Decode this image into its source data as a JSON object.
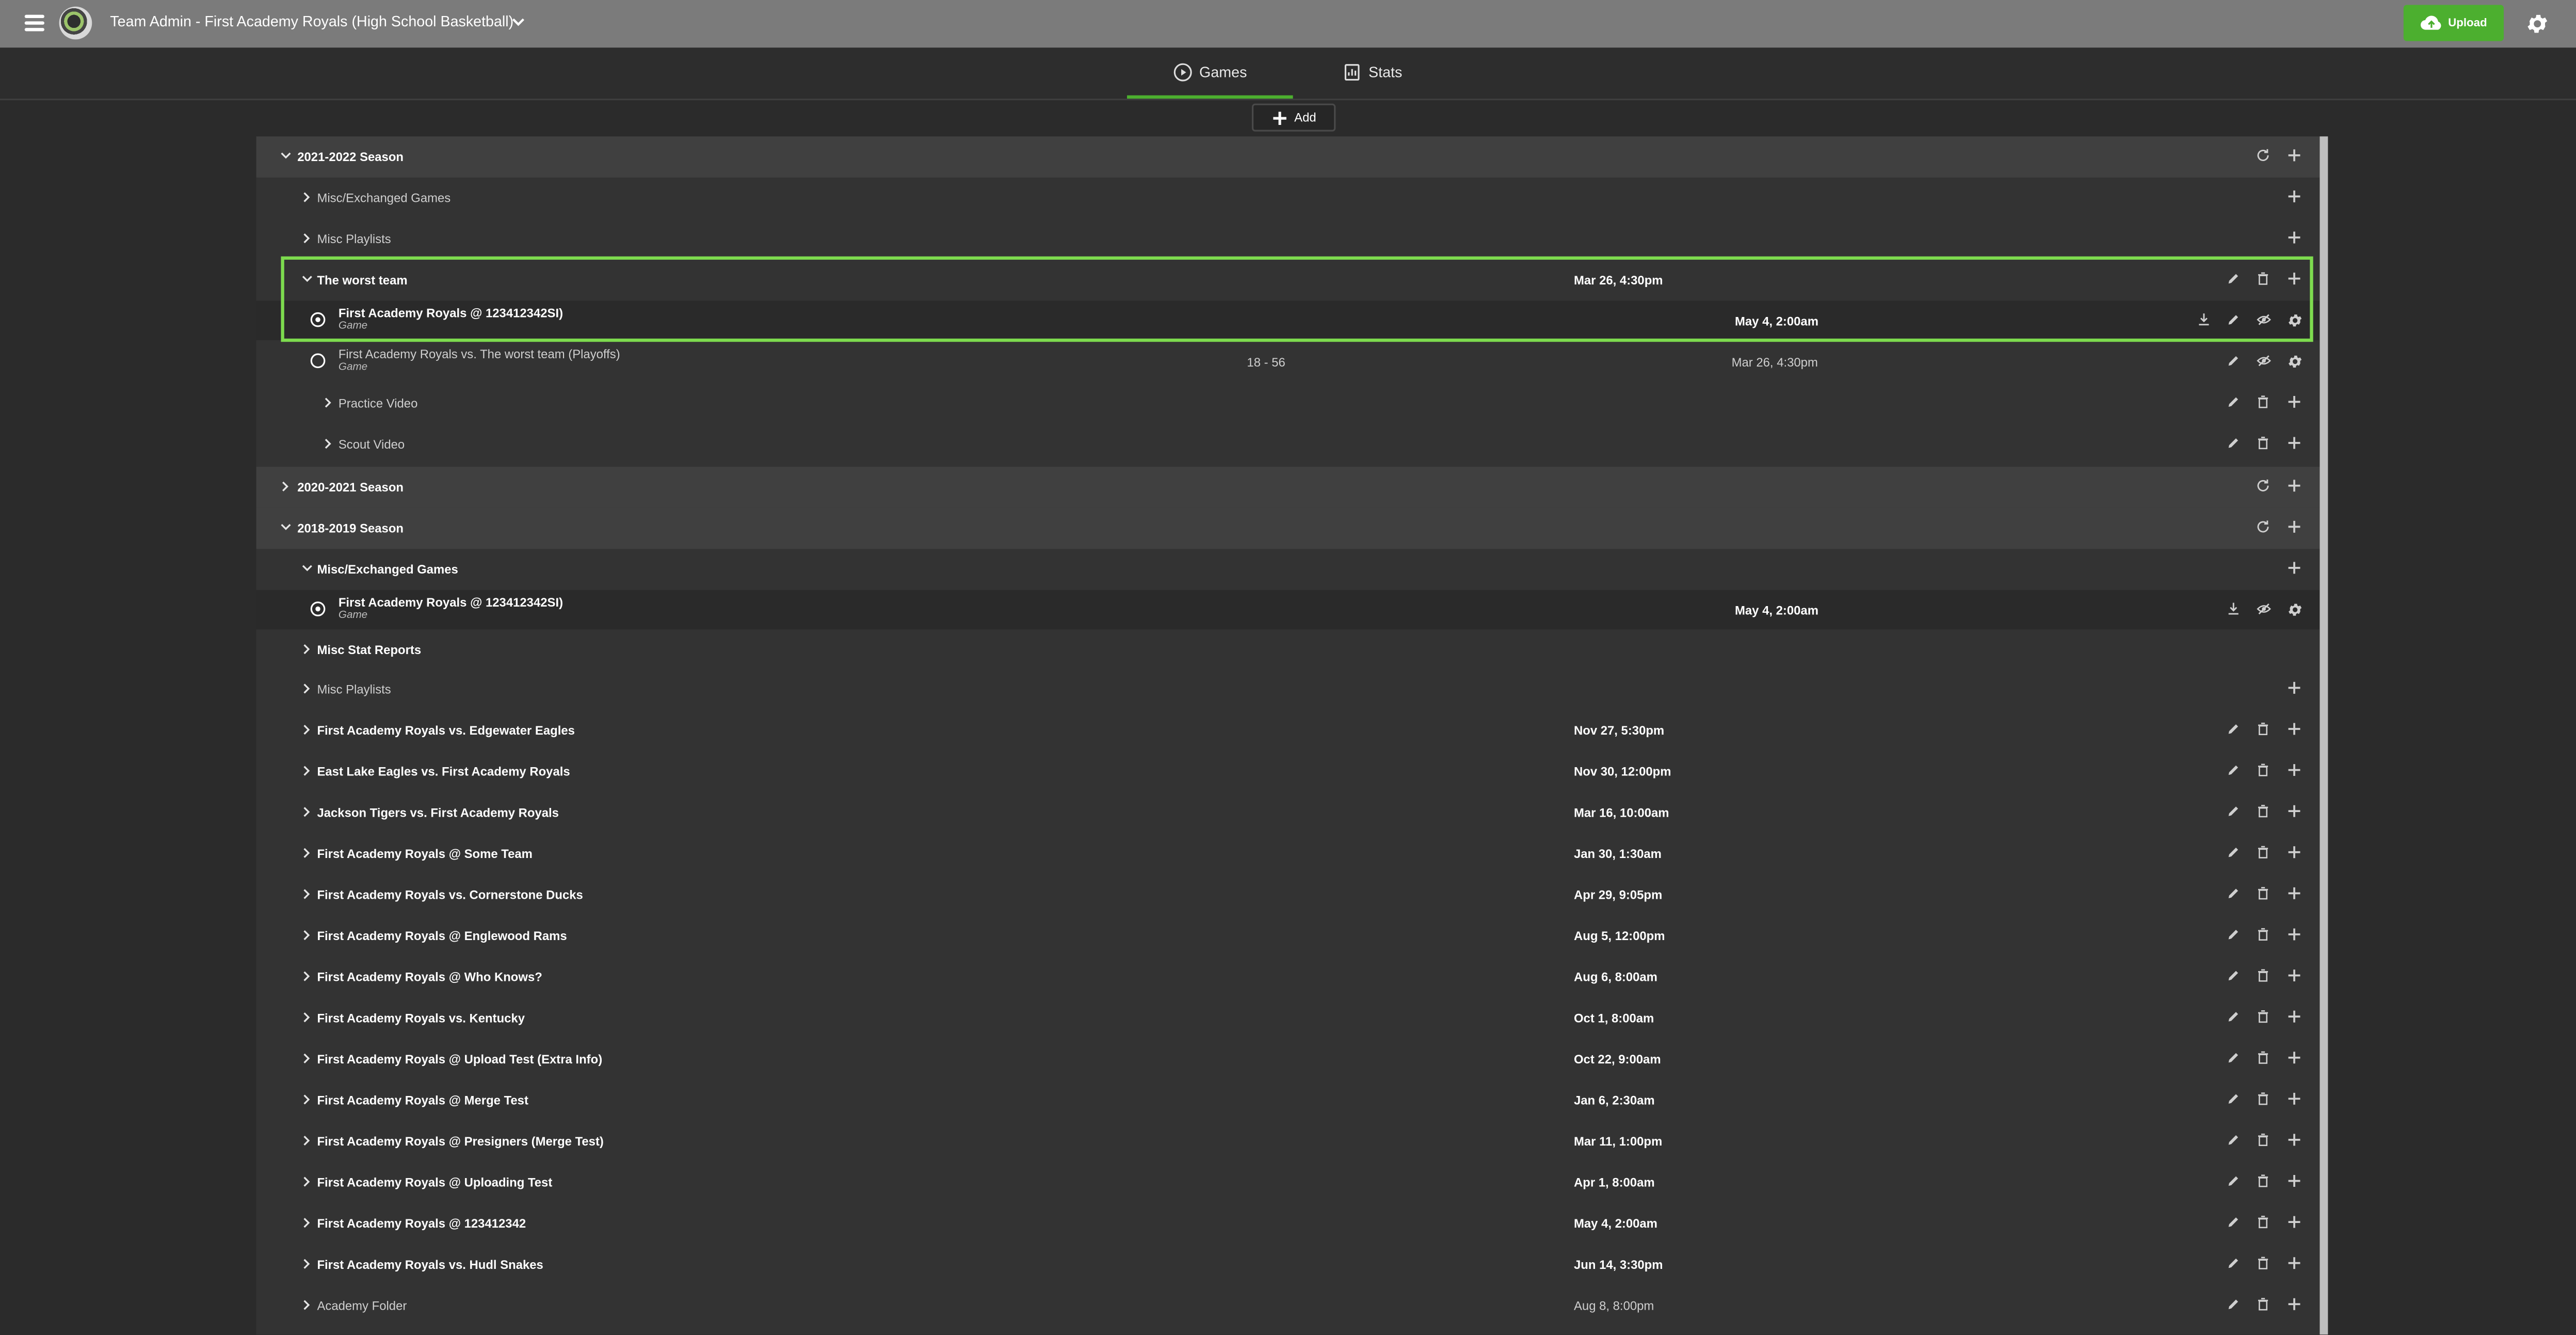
{
  "header": {
    "title": "Team Admin - First Academy Royals (High School Basketball)",
    "upload_label": "Upload",
    "accent_color": "#4caf2f",
    "icons": [
      "menu-icon",
      "team-logo",
      "chevron-down-icon",
      "cloud-upload-icon",
      "gear-icon"
    ]
  },
  "tabs": [
    {
      "label": "Games",
      "active": true
    },
    {
      "label": "Stats",
      "active": false
    }
  ],
  "toolbar": {
    "add_label": "Add"
  },
  "rows": {
    "r0": {
      "label": "2021-2022 Season"
    },
    "r1": {
      "label": "Misc/Exchanged Games"
    },
    "r2": {
      "label": "Misc Playlists"
    },
    "r3": {
      "label": "The worst team",
      "date": "Mar 26, 4:30pm"
    },
    "r4": {
      "label": "First Academy Royals @ 123412342SI)",
      "sub": "Game",
      "date": "May 4, 2:00am"
    },
    "r5": {
      "label": "First Academy Royals vs. The worst team (Playoffs)",
      "sub": "Game",
      "score": "18 - 56",
      "date": "Mar 26, 4:30pm"
    },
    "r6": {
      "label": "Practice Video"
    },
    "r7": {
      "label": "Scout Video"
    },
    "r8": {
      "label": "2020-2021 Season"
    },
    "r9": {
      "label": "2018-2019 Season"
    },
    "r10": {
      "label": "Misc/Exchanged Games"
    },
    "r11": {
      "label": "First Academy Royals @ 123412342SI)",
      "sub": "Game",
      "date": "May 4, 2:00am"
    },
    "r12": {
      "label": "Misc Stat Reports"
    },
    "r13": {
      "label": "Misc Playlists"
    },
    "r14": {
      "label": "First Academy Royals vs. Edgewater Eagles",
      "date": "Nov 27, 5:30pm"
    },
    "r15": {
      "label": "East Lake Eagles vs. First Academy Royals",
      "date": "Nov 30, 12:00pm"
    },
    "r16": {
      "label": "Jackson Tigers vs. First Academy Royals",
      "date": "Mar 16, 10:00am"
    },
    "r17": {
      "label": "First Academy Royals @ Some Team",
      "date": "Jan 30, 1:30am"
    },
    "r18": {
      "label": "First Academy Royals vs. Cornerstone Ducks",
      "date": "Apr 29, 9:05pm"
    },
    "r19": {
      "label": "First Academy Royals @ Englewood Rams",
      "date": "Aug 5, 12:00pm"
    },
    "r20": {
      "label": "First Academy Royals @ Who Knows?",
      "date": "Aug 6, 8:00am"
    },
    "r21": {
      "label": "First Academy Royals vs. Kentucky",
      "date": "Oct 1, 8:00am"
    },
    "r22": {
      "label": "First Academy Royals @ Upload Test (Extra Info)",
      "date": "Oct 22, 9:00am"
    },
    "r23": {
      "label": "First Academy Royals @ Merge Test",
      "date": "Jan 6, 2:30am"
    },
    "r24": {
      "label": "First Academy Royals @ Presigners (Merge Test)",
      "date": "Mar 11, 1:00pm"
    },
    "r25": {
      "label": "First Academy Royals @ Uploading Test",
      "date": "Apr 1, 8:00am"
    },
    "r26": {
      "label": "First Academy Royals @ 123412342",
      "date": "May 4, 2:00am"
    },
    "r27": {
      "label": "First Academy Royals vs. Hudl Snakes",
      "date": "Jun 14, 3:30pm"
    },
    "r28": {
      "label": "Academy Folder",
      "date": "Aug 8, 8:00pm"
    }
  }
}
